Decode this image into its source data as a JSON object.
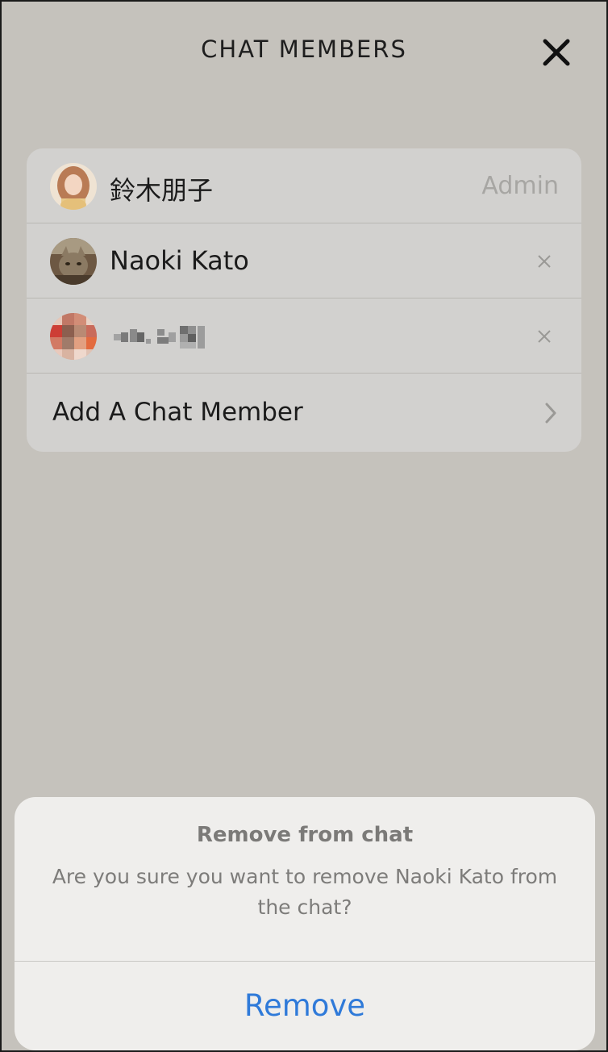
{
  "header": {
    "title": "CHAT MEMBERS",
    "close_icon": "close-icon"
  },
  "members": [
    {
      "name": "鈴木朋子",
      "role": "Admin",
      "avatar": "avatar-woman"
    },
    {
      "name": "Naoki Kato",
      "action_icon": "remove-x-icon",
      "avatar": "avatar-cat"
    },
    {
      "name": "",
      "action_icon": "remove-x-icon",
      "avatar": "avatar-pixelated",
      "name_obscured": true
    }
  ],
  "add_member": {
    "label": "Add A Chat Member",
    "icon": "chevron-right-icon"
  },
  "dialog": {
    "title": "Remove from chat",
    "message": "Are you sure you want to remove Naoki Kato from the chat?",
    "action_label": "Remove",
    "action_color": "#2f7ad9"
  },
  "colors": {
    "background": "#c5c2bc",
    "card": "#d2d1cf",
    "sheet": "#efeeec"
  }
}
